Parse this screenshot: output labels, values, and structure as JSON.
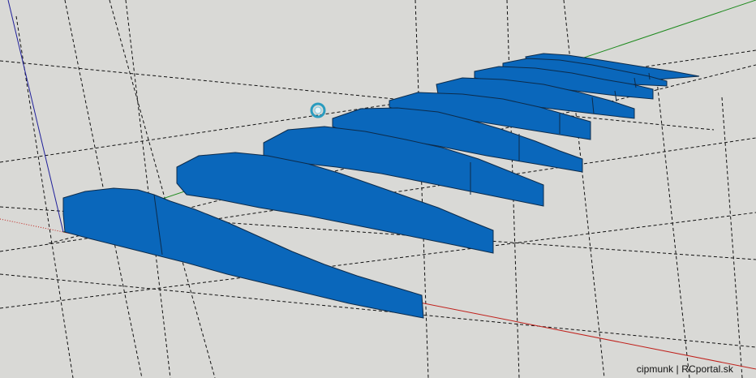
{
  "scene": {
    "background_color": "#d9d9d6",
    "part_fill": "#0a67bb",
    "part_edge": "#0d2b4a",
    "axis_colors": {
      "x": "#c0201b",
      "y": "#1e8a1e",
      "z": "#1f1f9a"
    },
    "guide_line_color": "#111111",
    "cursor_icon": "orbit-cursor-icon",
    "rib_count": 8
  },
  "watermark": {
    "text": "cipmunk | RCportal.sk"
  }
}
